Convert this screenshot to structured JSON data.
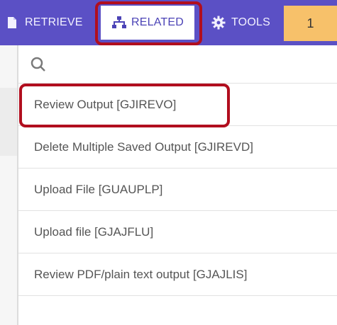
{
  "toolbar": {
    "retrieve_label": "RETRIEVE",
    "related_label": "RELATED",
    "tools_label": "TOOLS",
    "badge_count": "1",
    "colors": {
      "bar": "#5b50c5",
      "active_tab_bg": "#ffffff",
      "badge": "#f7c16a",
      "highlight": "#b10e1e"
    }
  },
  "search": {
    "value": "",
    "icon": "search-icon"
  },
  "results": [
    {
      "label": "Review Output [GJIREVO]"
    },
    {
      "label": "Delete Multiple Saved Output [GJIREVD]"
    },
    {
      "label": "Upload File [GUAUPLP]"
    },
    {
      "label": "Upload file [GJAJFLU]"
    },
    {
      "label": "Review PDF/plain text output [GJAJLIS]"
    }
  ]
}
